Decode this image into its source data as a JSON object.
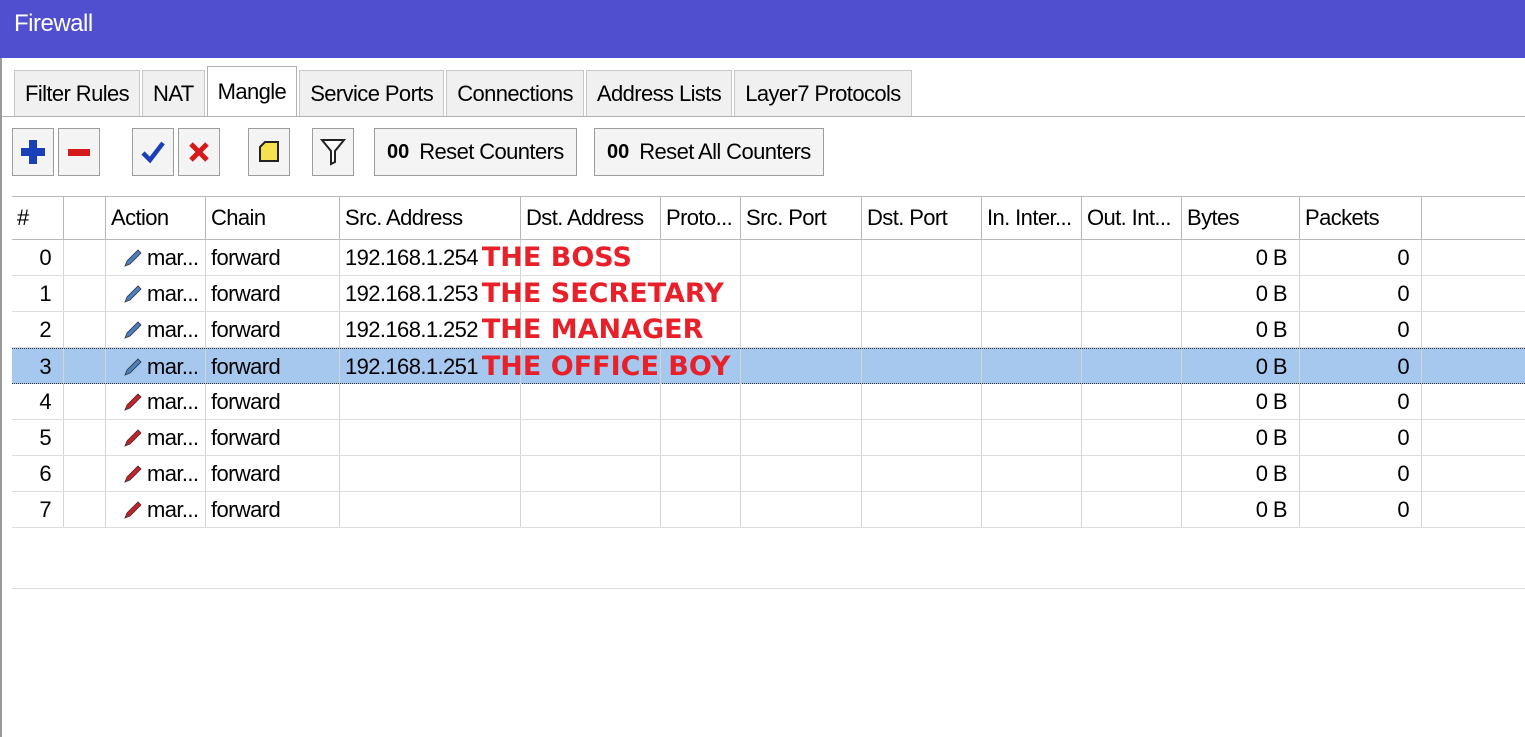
{
  "window": {
    "title": "Firewall"
  },
  "tabs": [
    {
      "label": "Filter Rules",
      "active": false
    },
    {
      "label": "NAT",
      "active": false
    },
    {
      "label": "Mangle",
      "active": true
    },
    {
      "label": "Service Ports",
      "active": false
    },
    {
      "label": "Connections",
      "active": false
    },
    {
      "label": "Address Lists",
      "active": false
    },
    {
      "label": "Layer7 Protocols",
      "active": false
    }
  ],
  "toolbar": {
    "add_icon": "plus-icon",
    "remove_icon": "minus-icon",
    "enable_icon": "check-icon",
    "disable_icon": "x-icon",
    "comment_icon": "note-icon",
    "filter_icon": "filter-icon",
    "reset_counters": {
      "prefix": "00",
      "label": "Reset Counters"
    },
    "reset_all_counters": {
      "prefix": "00",
      "label": "Reset All Counters"
    }
  },
  "table": {
    "columns": [
      "#",
      "",
      "Action",
      "Chain",
      "Src. Address",
      "Dst. Address",
      "Proto...",
      "Src. Port",
      "Dst. Port",
      "In. Inter...",
      "Out. Int...",
      "Bytes",
      "Packets"
    ],
    "rows": [
      {
        "num": "0",
        "action": "mar...",
        "chain": "forward",
        "src": "192.168.1.254",
        "note": "THE BOSS",
        "bytes": "0 B",
        "packets": "0",
        "selected": false,
        "pencil_color": "#4a7fc0"
      },
      {
        "num": "1",
        "action": "mar...",
        "chain": "forward",
        "src": "192.168.1.253",
        "note": "THE SECRETARY",
        "bytes": "0 B",
        "packets": "0",
        "selected": false,
        "pencil_color": "#4a7fc0"
      },
      {
        "num": "2",
        "action": "mar...",
        "chain": "forward",
        "src": "192.168.1.252",
        "note": "THE MANAGER",
        "bytes": "0 B",
        "packets": "0",
        "selected": false,
        "pencil_color": "#4a7fc0"
      },
      {
        "num": "3",
        "action": "mar...",
        "chain": "forward",
        "src": "192.168.1.251",
        "note": "THE OFFICE BOY",
        "bytes": "0 B",
        "packets": "0",
        "selected": true,
        "pencil_color": "#4a7fc0"
      },
      {
        "num": "4",
        "action": "mar...",
        "chain": "forward",
        "src": "",
        "note": "",
        "bytes": "0 B",
        "packets": "0",
        "selected": false,
        "pencil_color": "#c8202a"
      },
      {
        "num": "5",
        "action": "mar...",
        "chain": "forward",
        "src": "",
        "note": "",
        "bytes": "0 B",
        "packets": "0",
        "selected": false,
        "pencil_color": "#c8202a"
      },
      {
        "num": "6",
        "action": "mar...",
        "chain": "forward",
        "src": "",
        "note": "",
        "bytes": "0 B",
        "packets": "0",
        "selected": false,
        "pencil_color": "#c8202a"
      },
      {
        "num": "7",
        "action": "mar...",
        "chain": "forward",
        "src": "",
        "note": "",
        "bytes": "0 B",
        "packets": "0",
        "selected": false,
        "pencil_color": "#c8202a"
      }
    ]
  },
  "colors": {
    "titlebar": "#4f4fcf",
    "selected_row": "#a6c8ee",
    "annotation": "#e8202a"
  }
}
